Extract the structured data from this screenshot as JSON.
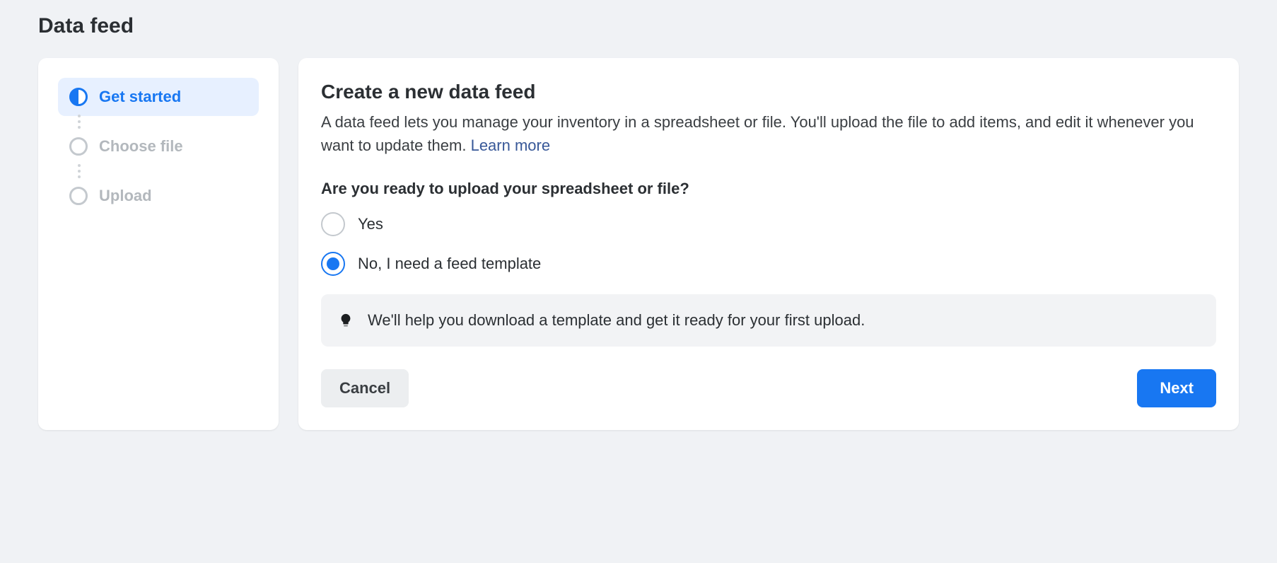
{
  "page": {
    "title": "Data feed"
  },
  "sidebar": {
    "steps": [
      {
        "label": "Get started",
        "active": true
      },
      {
        "label": "Choose file",
        "active": false
      },
      {
        "label": "Upload",
        "active": false
      }
    ]
  },
  "main": {
    "heading": "Create a new data feed",
    "description_prefix": "A data feed lets you manage your inventory in a spreadsheet or file. You'll upload the file to add items, and edit it whenever you want to update them. ",
    "learn_more": "Learn more",
    "question": "Are you ready to upload your spreadsheet or file?",
    "options": [
      {
        "label": "Yes",
        "selected": false
      },
      {
        "label": "No, I need a feed template",
        "selected": true
      }
    ],
    "info_text": "We'll help you download a template and get it ready for your first upload.",
    "cancel_label": "Cancel",
    "next_label": "Next"
  }
}
